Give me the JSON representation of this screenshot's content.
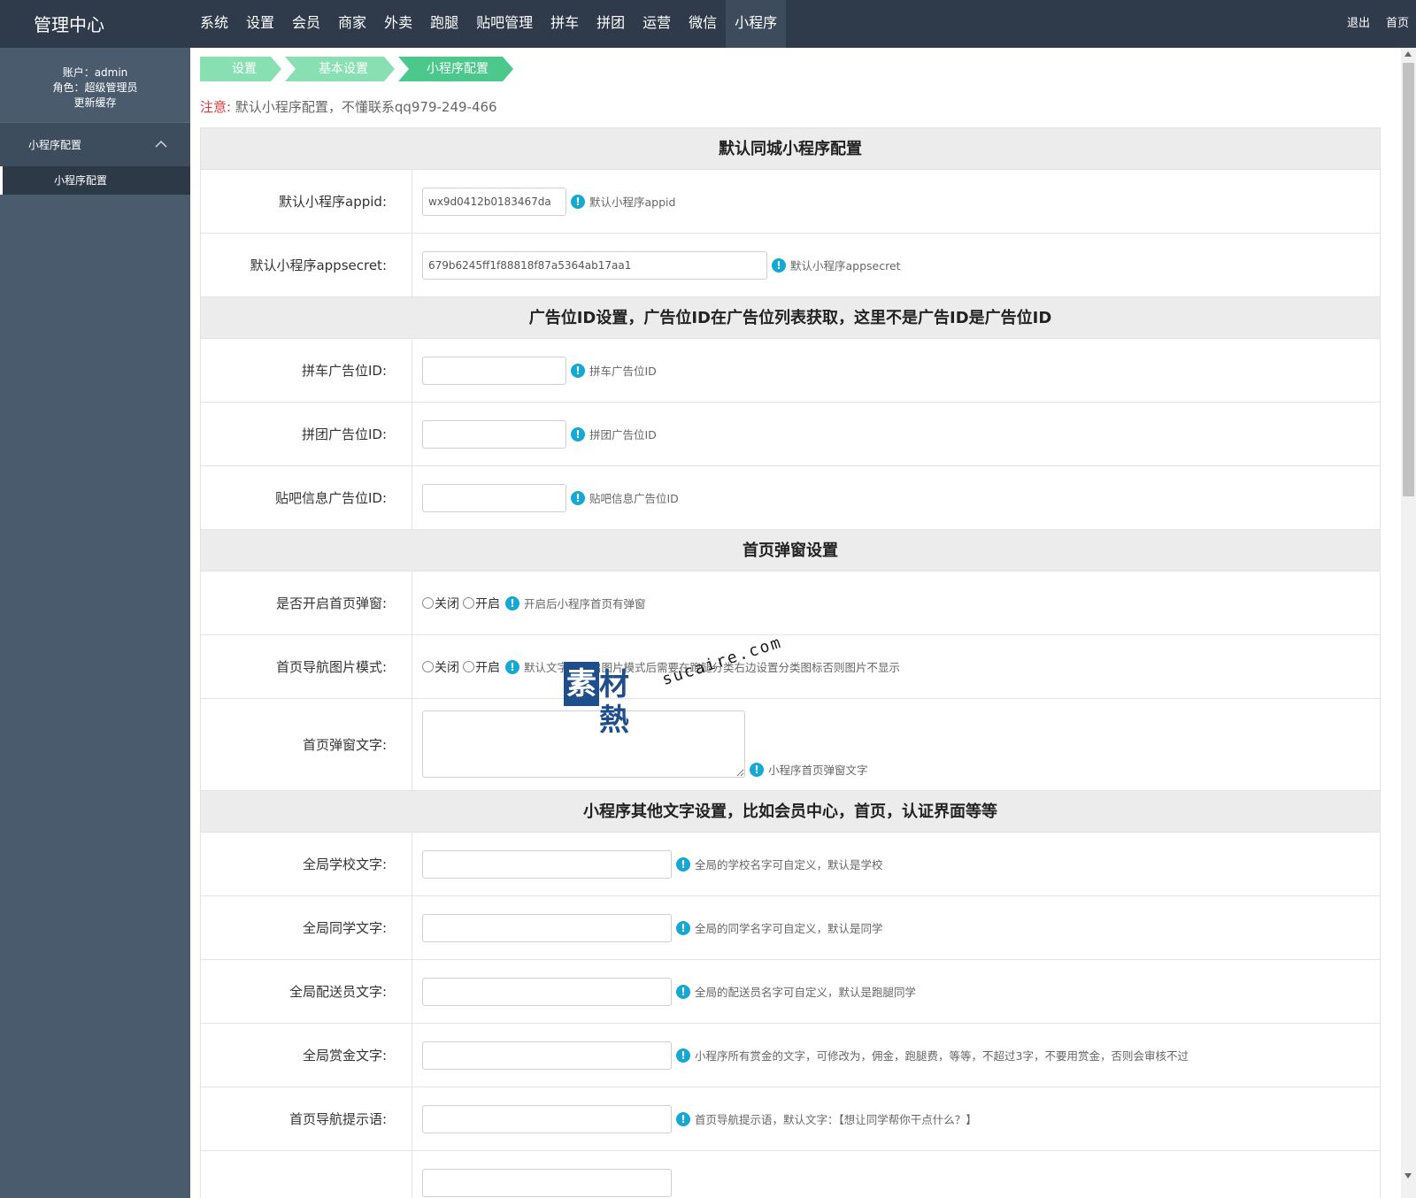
{
  "header": {
    "brand": "管理中心",
    "nav": [
      "系统",
      "设置",
      "会员",
      "商家",
      "外卖",
      "跑腿",
      "贴吧管理",
      "拼车",
      "拼团",
      "运营",
      "微信",
      "小程序"
    ],
    "active_nav": "小程序",
    "logout": "退出",
    "home": "首页"
  },
  "sidebar": {
    "account": "账户：admin",
    "role": "角色：超级管理员",
    "refresh": "更新缓存",
    "group": "小程序配置",
    "sub_item": "小程序配置"
  },
  "breadcrumb": [
    "设置",
    "基本设置",
    "小程序配置"
  ],
  "notice": {
    "label": "注意:",
    "text": "默认小程序配置，不懂联系qq979-249-466"
  },
  "sections": {
    "s1": "默认同城小程序配置",
    "s2": "广告位ID设置，广告位ID在广告位列表获取，这里不是广告ID是广告位ID",
    "s3": "首页弹窗设置",
    "s4": "小程序其他文字设置，比如会员中心，首页，认证界面等等"
  },
  "fields": {
    "appid": {
      "label": "默认小程序appid:",
      "value": "wx9d0412b0183467da",
      "tip": "默认小程序appid"
    },
    "appsecret": {
      "label": "默认小程序appsecret:",
      "value": "679b6245ff1f88818f87a5364ab17aa1",
      "tip": "默认小程序appsecret"
    },
    "carpool_ad": {
      "label": "拼车广告位ID:",
      "value": "",
      "tip": "拼车广告位ID"
    },
    "group_ad": {
      "label": "拼团广告位ID:",
      "value": "",
      "tip": "拼团广告位ID"
    },
    "post_ad": {
      "label": "贴吧信息广告位ID:",
      "value": "",
      "tip": "贴吧信息广告位ID"
    },
    "popup_enable": {
      "label": "是否开启首页弹窗:",
      "off": "关闭",
      "on": "开启",
      "tip": "开启后小程序首页有弹窗"
    },
    "nav_image_mode": {
      "label": "首页导航图片模式:",
      "off": "关闭",
      "on": "开启",
      "tip": "默认文字，开启图片模式后需要在跑腿分类右边设置分类图标否则图片不显示"
    },
    "popup_text": {
      "label": "首页弹窗文字:",
      "value": "",
      "tip": "小程序首页弹窗文字"
    },
    "school_text": {
      "label": "全局学校文字:",
      "value": "",
      "tip": "全局的学校名字可自定义，默认是学校"
    },
    "classmate_text": {
      "label": "全局同学文字:",
      "value": "",
      "tip": "全局的同学名字可自定义，默认是同学"
    },
    "courier_text": {
      "label": "全局配送员文字:",
      "value": "",
      "tip": "全局的配送员名字可自定义，默认是跑腿同学"
    },
    "reward_text": {
      "label": "全局赏金文字:",
      "value": "",
      "tip": "小程序所有赏金的文字，可修改为，佣金，跑腿费，等等，不超过3字，不要用赏金，否则会审核不过"
    },
    "nav_hint": {
      "label": "首页导航提示语:",
      "value": "",
      "tip": "首页导航提示语，默认文字：【想让同学帮你干点什么？】"
    }
  },
  "watermark": {
    "cn1": "素",
    "cn2": "材熱",
    "domain": "sucaire.com"
  },
  "colors": {
    "topbar": "#2f3b4a",
    "sidebar": "#4a5b6d",
    "crumb": "#88e0b2",
    "crumb_active": "#4cc88c",
    "info_icon": "#14a8d4",
    "warn": "#d93a3a"
  }
}
